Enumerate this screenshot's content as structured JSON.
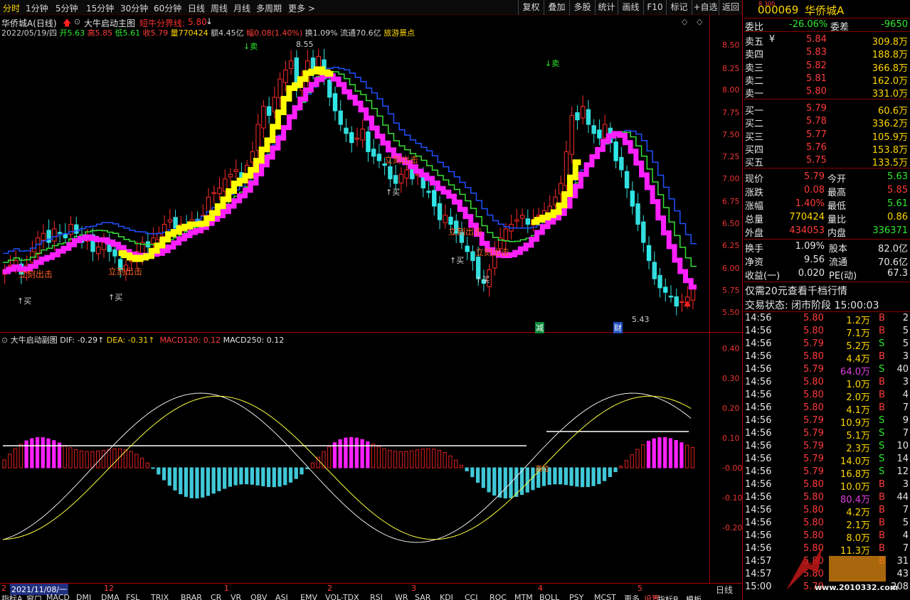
{
  "toolbar": {
    "tabs": [
      "分时",
      "1分钟",
      "5分钟",
      "15分钟",
      "30分钟",
      "60分钟",
      "日线",
      "周线",
      "月线",
      "多周期",
      "更多 >"
    ],
    "buttons": [
      "复权",
      "叠加",
      "多股",
      "统计",
      "画线",
      "F10",
      "标记",
      "+自选",
      "返回"
    ]
  },
  "main_chart": {
    "stock_title": "华侨城A(日线)",
    "indicator_name": "大牛启动主图",
    "boundary_label": "短牛分界线:",
    "boundary_value": "5.80",
    "info": {
      "date": "2022/05/19/四",
      "open": "开5.63",
      "high": "高5.85",
      "low": "低5.61",
      "close": "收5.79",
      "vol": "量770424",
      "amt": "额4.45亿",
      "chg": "幅0.08(1.40%)",
      "turn": "换1.09%",
      "float": "流通70.6亿",
      "concept": "旅游景点"
    },
    "y_ticks": [
      "8.50",
      "8.25",
      "8.00",
      "7.75",
      "7.50",
      "7.25",
      "7.00",
      "6.75",
      "6.50",
      "6.25",
      "6.00",
      "5.75",
      "5.50"
    ],
    "marker_labels": [
      "↑买",
      "↑买",
      "立刻出击",
      "立刻出击",
      "↓卖",
      "立刻出击",
      "↑买",
      "立刻出击",
      "↑买",
      "↑买",
      "↓卖",
      "立刻出击",
      "8.55",
      "5.43"
    ],
    "event_labels": [
      "减",
      "财"
    ]
  },
  "sub_chart": {
    "title": "大牛启动副图",
    "dif": "DIF: -0.29↑",
    "dea": "DEA: -0.31↑",
    "macd120": "MACD120: 0.12",
    "macd250": "MACD250: 0.12",
    "y_ticks": [
      "0.40",
      "0.30",
      "0.20",
      "0.10",
      "-0.00",
      "-0.10",
      "-0.20"
    ],
    "overlay": "高拉"
  },
  "x_axis": {
    "date": "2021/11/08/一",
    "labels": [
      "2",
      "12",
      "1",
      "2",
      "3",
      "4",
      "5"
    ],
    "period": "日线"
  },
  "bottom_tabs": [
    "指标A",
    "窗口",
    "MACD",
    "DMI",
    "DMA",
    "FSL",
    "TRIX",
    "BRAR",
    "CR",
    "VR",
    "OBV",
    "ASI",
    "EMV",
    "VOL-TDX",
    "RSI",
    "WR",
    "SAR",
    "KDJ",
    "CCI",
    "ROC",
    "MTM",
    "BOLL",
    "PSY",
    "MCST",
    "更多",
    "设置"
  ],
  "bottom_right": [
    "指标B",
    "模板"
  ],
  "quote": {
    "market": "R 300",
    "code": "000069",
    "name": "华侨城A",
    "weibi_label": "委比",
    "weibi": "-26.06%",
    "weicha_label": "委差",
    "weicha": "-9650",
    "asks": [
      {
        "label": "卖五",
        "mark": "¥",
        "price": "5.84",
        "vol": "309.8万"
      },
      {
        "label": "卖四",
        "price": "5.83",
        "vol": "188.8万"
      },
      {
        "label": "卖三",
        "price": "5.82",
        "vol": "366.8万"
      },
      {
        "label": "卖二",
        "price": "5.81",
        "vol": "162.0万"
      },
      {
        "label": "卖一",
        "price": "5.80",
        "vol": "331.0万"
      }
    ],
    "bids": [
      {
        "label": "买一",
        "price": "5.79",
        "vol": "60.6万"
      },
      {
        "label": "买二",
        "price": "5.78",
        "vol": "336.2万"
      },
      {
        "label": "买三",
        "price": "5.77",
        "vol": "105.9万"
      },
      {
        "label": "买四",
        "price": "5.76",
        "vol": "153.8万"
      },
      {
        "label": "买五",
        "price": "5.75",
        "vol": "133.5万"
      }
    ],
    "stats": [
      {
        "l1": "现价",
        "v1": "5.79",
        "l2": "今开",
        "v2": "5.63",
        "c1": "#ff3b3b",
        "c2": "#2ee82e"
      },
      {
        "l1": "涨跌",
        "v1": "0.08",
        "l2": "最高",
        "v2": "5.85",
        "c1": "#ff3b3b",
        "c2": "#ff3b3b"
      },
      {
        "l1": "涨幅",
        "v1": "1.40%",
        "l2": "最低",
        "v2": "5.61",
        "c1": "#ff3b3b",
        "c2": "#2ee82e"
      },
      {
        "l1": "总量",
        "v1": "770424",
        "l2": "量比",
        "v2": "0.86",
        "c1": "#ffd700",
        "c2": "#ffd700"
      },
      {
        "l1": "外盘",
        "v1": "434053",
        "l2": "内盘",
        "v2": "336371",
        "c1": "#ff3b3b",
        "c2": "#2ee82e"
      }
    ],
    "stats2": [
      {
        "l1": "换手",
        "v1": "1.09%",
        "l2": "股本",
        "v2": "82.0亿"
      },
      {
        "l1": "净资",
        "v1": "9.56",
        "l2": "流通",
        "v2": "70.6亿"
      },
      {
        "l1": "收益(一)",
        "v1": "0.020",
        "l2": "PE(动)",
        "v2": "67.3"
      }
    ],
    "promo": "仅需20元查看千档行情",
    "status": "交易状态: 闭市阶段 15:00:03",
    "ticks": [
      {
        "t": "14:56",
        "p": "5.80",
        "v": "1.2万",
        "d": "B",
        "n": "2"
      },
      {
        "t": "14:56",
        "p": "5.80",
        "v": "7.1万",
        "d": "B",
        "n": "5"
      },
      {
        "t": "14:56",
        "p": "5.79",
        "v": "5.2万",
        "d": "S",
        "n": "5"
      },
      {
        "t": "14:56",
        "p": "5.80",
        "v": "4.4万",
        "d": "B",
        "n": "3"
      },
      {
        "t": "14:56",
        "p": "5.79",
        "v": "64.0万",
        "d": "S",
        "n": "40"
      },
      {
        "t": "14:56",
        "p": "5.80",
        "v": "1.0万",
        "d": "B",
        "n": "3"
      },
      {
        "t": "14:56",
        "p": "5.80",
        "v": "2.0万",
        "d": "B",
        "n": "4"
      },
      {
        "t": "14:56",
        "p": "5.80",
        "v": "4.1万",
        "d": "B",
        "n": "7"
      },
      {
        "t": "14:56",
        "p": "5.79",
        "v": "10.9万",
        "d": "S",
        "n": "9"
      },
      {
        "t": "14:56",
        "p": "5.79",
        "v": "5.1万",
        "d": "S",
        "n": "7"
      },
      {
        "t": "14:56",
        "p": "5.79",
        "v": "2.3万",
        "d": "S",
        "n": "10"
      },
      {
        "t": "14:56",
        "p": "5.79",
        "v": "14.0万",
        "d": "S",
        "n": "14"
      },
      {
        "t": "14:56",
        "p": "5.79",
        "v": "16.8万",
        "d": "S",
        "n": "12"
      },
      {
        "t": "14:56",
        "p": "5.80",
        "v": "10.0万",
        "d": "B",
        "n": "3"
      },
      {
        "t": "14:56",
        "p": "5.80",
        "v": "80.4万",
        "d": "B",
        "n": "44"
      },
      {
        "t": "14:56",
        "p": "5.80",
        "v": "4.2万",
        "d": "B",
        "n": "7"
      },
      {
        "t": "14:56",
        "p": "5.80",
        "v": "2.1万",
        "d": "B",
        "n": "5"
      },
      {
        "t": "14:56",
        "p": "5.80",
        "v": "8.0万",
        "d": "B",
        "n": "4"
      },
      {
        "t": "14:56",
        "p": "5.80",
        "v": "11.3万",
        "d": "B",
        "n": "7"
      },
      {
        "t": "14:57",
        "p": "5.80",
        "v": "",
        "d": "B",
        "n": "31"
      },
      {
        "t": "14:57",
        "p": "5.80",
        "v": "",
        "d": "",
        "n": "43"
      },
      {
        "t": "15:00",
        "p": "5.79",
        "v": "",
        "d": "",
        "n": "208"
      }
    ]
  },
  "watermark": "www.2010332.com",
  "chart_data": {
    "type": "candlestick",
    "y_range": [
      5.4,
      8.65
    ],
    "closes": [
      6.0,
      6.05,
      6.1,
      5.95,
      6.05,
      6.2,
      6.35,
      6.4,
      6.3,
      6.45,
      6.4,
      6.35,
      6.5,
      6.4,
      6.3,
      6.35,
      6.2,
      6.25,
      6.3,
      6.2,
      6.15,
      6.0,
      6.05,
      6.1,
      6.2,
      6.3,
      6.25,
      6.35,
      6.4,
      6.5,
      6.55,
      6.45,
      6.5,
      6.45,
      6.55,
      6.5,
      6.6,
      6.8,
      6.85,
      6.9,
      7.0,
      7.05,
      7.1,
      7.0,
      7.15,
      7.3,
      7.6,
      7.8,
      7.7,
      7.9,
      8.1,
      8.2,
      8.3,
      8.0,
      8.1,
      8.3,
      8.2,
      8.35,
      8.1,
      7.9,
      7.75,
      7.6,
      7.5,
      7.4,
      7.45,
      7.55,
      7.3,
      7.25,
      7.2,
      7.15,
      7.0,
      6.95,
      7.05,
      7.1,
      7.0,
      7.05,
      6.9,
      6.85,
      6.7,
      6.55,
      6.6,
      6.5,
      6.4,
      6.3,
      6.2,
      6.1,
      5.9,
      5.85,
      6.0,
      6.2,
      6.35,
      6.45,
      6.5,
      6.55,
      6.6,
      6.5,
      6.55,
      6.6,
      6.65,
      6.7,
      6.8,
      6.95,
      7.3,
      7.7,
      7.65,
      7.8,
      7.6,
      7.5,
      7.45,
      7.6,
      7.4,
      7.2,
      7.1,
      6.9,
      6.7,
      6.5,
      6.3,
      6.1,
      5.9,
      5.8,
      5.75,
      5.7,
      5.6,
      5.65,
      5.7,
      5.79
    ]
  }
}
